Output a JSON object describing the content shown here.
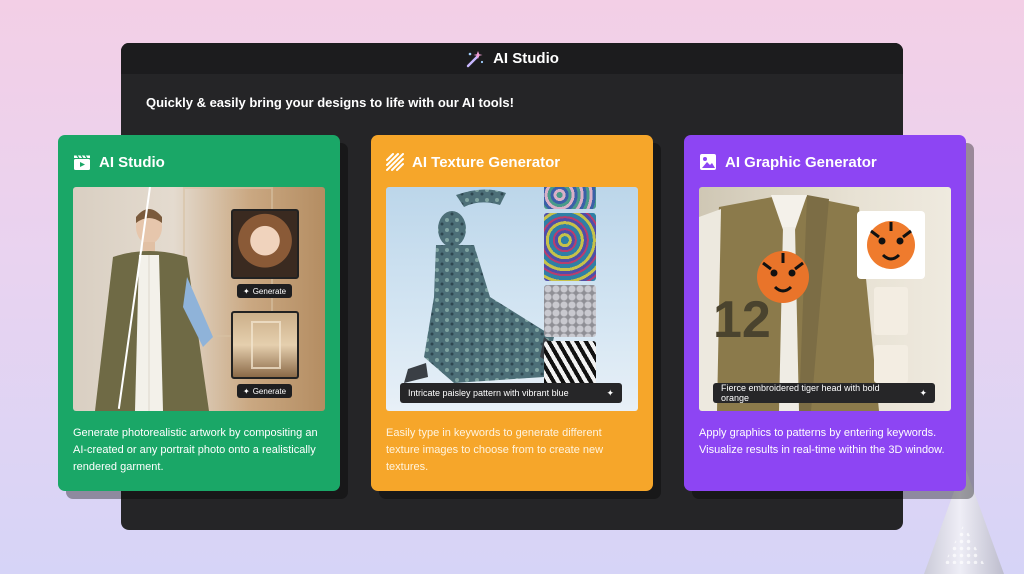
{
  "window": {
    "title": "AI Studio",
    "tagline": "Quickly & easily bring your designs to life with our AI tools!"
  },
  "cards": [
    {
      "title": "AI Studio",
      "description": "Generate photorealistic artwork by compositing an AI-created or any portrait photo onto a realistically rendered garment.",
      "generate_buttons": [
        "Generate",
        "Generate"
      ],
      "color": "#1aa767",
      "icon": "clapperboard-icon"
    },
    {
      "title": "AI Texture Generator",
      "description": "Easily type in keywords to generate different texture images to choose from to create new textures.",
      "prompt": "Intricate paisley pattern with vibrant blue",
      "color": "#f6a62a",
      "icon": "texture-stripes-icon"
    },
    {
      "title": "AI Graphic Generator",
      "description": "Apply graphics to patterns by entering keywords. Visualize results in real-time within the 3D window.",
      "prompt": "Fierce embroidered tiger head with bold orange",
      "color": "#8d45f3",
      "icon": "image-icon"
    }
  ],
  "colors": {
    "window_bg": "#252527",
    "titlebar_bg": "#1c1c1e",
    "page_bg_top": "#f3cfe6",
    "page_bg_bottom": "#d6d4f7"
  }
}
